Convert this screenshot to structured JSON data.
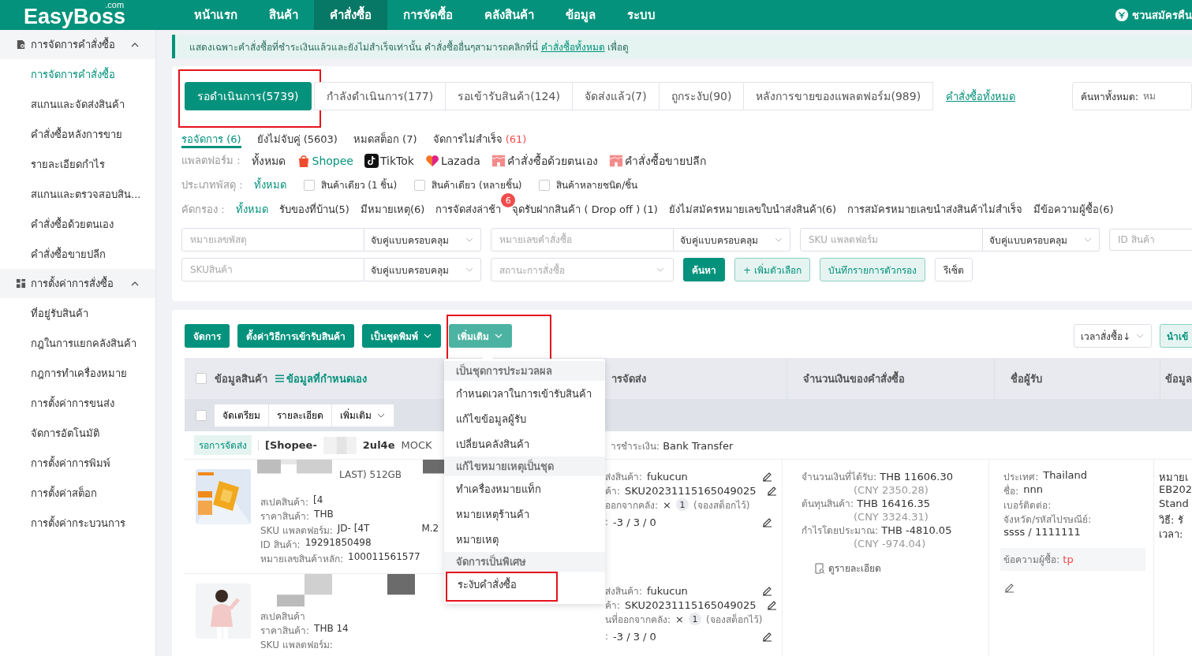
{
  "logo": {
    "text": "EasyBoss",
    "suffix": ".com"
  },
  "nav": [
    {
      "label": "หน้าแรก",
      "selected": false
    },
    {
      "label": "สินค้า",
      "selected": false
    },
    {
      "label": "คำสั่งซื้อ",
      "selected": true
    },
    {
      "label": "การจัดซื้อ",
      "selected": false
    },
    {
      "label": "คลังสินค้า",
      "selected": false
    },
    {
      "label": "ข้อมูล",
      "selected": false
    },
    {
      "label": "ระบบ",
      "selected": false
    }
  ],
  "invite": "ชวนสมัครคืน",
  "sidebar": [
    {
      "label": "การจัดการคำสั่งซื้อ",
      "kind": "doc",
      "expanded": true,
      "children": [
        {
          "label": "การจัดการคำสั่งซื้อ",
          "selected": true
        },
        {
          "label": "สแกนและจัดส่งสินค้า",
          "selected": false
        },
        {
          "label": "คำสั่งซื้อหลังการขาย",
          "selected": false
        },
        {
          "label": "รายละเอียดกำไร",
          "selected": false
        },
        {
          "label": "สแกนและตรวจสอบสิน...",
          "selected": false
        },
        {
          "label": "คำสั่งซื้อด้วยตนเอง",
          "selected": false
        },
        {
          "label": "คำสั่งซื้อขายปลีก",
          "selected": false
        }
      ]
    },
    {
      "label": "การตั้งค่าการสั่งซื้อ",
      "kind": "grid",
      "expanded": true,
      "children": [
        {
          "label": "ที่อยู่รับสินค้า",
          "selected": false
        },
        {
          "label": "กฎในการแยกคลังสินค้า",
          "selected": false
        },
        {
          "label": "กฎการทำเครื่องหมาย",
          "selected": false
        },
        {
          "label": "การตั้งค่าการขนส่ง",
          "selected": false
        },
        {
          "label": "จัดการอัตโนมัติ",
          "selected": false
        },
        {
          "label": "การตั้งค่าการพิมพ์",
          "selected": false
        },
        {
          "label": "การตั้งค่าสต็อก",
          "selected": false
        },
        {
          "label": "การตั้งค่ากระบวนการ",
          "selected": false
        }
      ]
    }
  ],
  "notice": {
    "text": "แสดงเฉพาะคำสั่งซื้อที่ชำระเงินแล้วและยังไม่สำเร็จเท่านั้น คำสั่งซื้ออื่นๆสามารถคลิกที่นี่",
    "link": "คำสั่งซื้อทั้งหมด",
    "tail": "เพื่อดู"
  },
  "status_tabs": [
    {
      "label": "รอดำเนินการ(5739)",
      "selected": true,
      "highlighted": true
    },
    {
      "label": "กำลังดำเนินการ(177)",
      "selected": false,
      "highlighted": false
    },
    {
      "label": "รอเข้ารับสินค้า(124)",
      "selected": false,
      "highlighted": false
    },
    {
      "label": "จัดส่งแล้ว(7)",
      "selected": false,
      "highlighted": false
    },
    {
      "label": "ถูกระงับ(90)",
      "selected": false,
      "highlighted": false
    },
    {
      "label": "หลังการขายของแพลตฟอร์ม(989)",
      "selected": false,
      "highlighted": false
    }
  ],
  "all_orders_link": "คำสั่งซื้อทั้งหมด",
  "global_search": {
    "label": "ค้นหาทั้งหมด:",
    "placeholder": "หม"
  },
  "sub_tabs": [
    {
      "label": "รอจัดการ",
      "count": "(6)",
      "selected": true,
      "alert": false
    },
    {
      "label": "ยังไม่จับคู่",
      "count": "(5603)",
      "selected": false,
      "alert": false
    },
    {
      "label": "หมดสต็อก",
      "count": "(7)",
      "selected": false,
      "alert": false
    },
    {
      "label": "จัดการไม่สำเร็จ",
      "count": "(61)",
      "selected": false,
      "alert": true
    }
  ],
  "platform": {
    "label": "แพลตฟอร์ม :",
    "options": [
      {
        "label": "ทั้งหมด",
        "kind": "all",
        "selected": false
      },
      {
        "label": "Shopee",
        "kind": "shopee",
        "selected": true
      },
      {
        "label": "TikTok",
        "kind": "tiktok",
        "selected": false
      },
      {
        "label": "Lazada",
        "kind": "lazada",
        "selected": false
      },
      {
        "label": "คำสั่งซื้อด้วยตนเอง",
        "kind": "store",
        "selected": false
      },
      {
        "label": "คำสั่งซื้อขายปลีก",
        "kind": "store",
        "selected": false
      }
    ]
  },
  "package_type": {
    "label": "ประเภทพัสดุ :",
    "all": {
      "label": "ทั้งหมด",
      "selected": true
    },
    "options": [
      {
        "label": "สินค้าเดียว (1 ชิ้น)",
        "checked": false
      },
      {
        "label": "สินค้าเดียว (หลายชิ้น)",
        "checked": false
      },
      {
        "label": "สินค้าหลายชนิด/ชิ้น",
        "checked": false
      }
    ]
  },
  "filters": {
    "label": "คัดกรอง :",
    "options": [
      {
        "label": "ทั้งหมด",
        "selected": true
      },
      {
        "label": "รับของที่บ้าน(5)",
        "selected": false
      },
      {
        "label": "มีหมายเหตุ(6)",
        "selected": false
      },
      {
        "label": "การจัดส่งล่าช้า",
        "selected": false,
        "badge": "6"
      },
      {
        "label": "จุดรับฝากสินค้า ( Drop off ) (1)",
        "selected": false
      },
      {
        "label": "ยังไม่สมัครหมายเลขใบนำส่งสินค้า(6)",
        "selected": false
      },
      {
        "label": "การสมัครหมายเลขนำส่งสินค้าไม่สำเร็จ",
        "selected": false
      },
      {
        "label": "มีข้อความผู้ซื้อ(6)",
        "selected": false
      }
    ]
  },
  "search_rows": [
    [
      {
        "kind": "text",
        "placeholder": "หมายเลขพัสดุ",
        "match": "จับคู่แบบครอบคลุม"
      },
      {
        "kind": "text",
        "placeholder": "หมายเลขคำสั่งซื้อ",
        "match": "จับคู่แบบครอบคลุม"
      },
      {
        "kind": "text",
        "placeholder": "SKU แพลตฟอร์ม",
        "match": "จับคู่แบบครอบคลุม"
      },
      {
        "kind": "plain",
        "placeholder": "ID สินค้า"
      }
    ],
    [
      {
        "kind": "text",
        "placeholder": "SKUสินค้า",
        "match": "จับคู่แบบครอบคลุม"
      },
      {
        "kind": "select",
        "placeholder": "สถานะการสั่งซื้อ"
      }
    ]
  ],
  "filter_buttons": [
    {
      "label": "ค้นหา",
      "kind": "primary"
    },
    {
      "label": "+ เพิ่มตัวเลือก",
      "kind": "light"
    },
    {
      "label": "บันทึกรายการตัวกรอง",
      "kind": "light"
    },
    {
      "label": "รีเซ็ต",
      "kind": "plain"
    }
  ],
  "toolbar": [
    {
      "label": "จัดการ",
      "caret": false,
      "active": false,
      "highlighted": false
    },
    {
      "label": "ตั้งค่าวิธีการเข้ารับสินค้า",
      "caret": false,
      "active": false,
      "highlighted": false
    },
    {
      "label": "เป็นชุดพิมพ์",
      "caret": true,
      "active": false,
      "highlighted": false
    },
    {
      "label": "เพิ่มเติม",
      "caret": true,
      "active": true,
      "highlighted": true
    }
  ],
  "sort": "เวลาสั่งซื้อ↓",
  "import_button": "นำเข้",
  "more_menu": [
    {
      "label": "เป็นชุดการประมวลผล",
      "kind": "group",
      "highlighted": false
    },
    {
      "label": "กำหนดเวลาในการเข้ารับสินค้า",
      "kind": "item",
      "highlighted": false
    },
    {
      "label": "แก้ไขข้อมูลผู้รับ",
      "kind": "item",
      "highlighted": false
    },
    {
      "label": "เปลี่ยนคลังสินค้า",
      "kind": "item",
      "highlighted": false
    },
    {
      "label": "แก้ไขหมายเหตุเป็นชุด",
      "kind": "group",
      "highlighted": false
    },
    {
      "label": "ทำเครื่องหมายแท็ก",
      "kind": "item",
      "highlighted": false
    },
    {
      "label": "หมายเหตุร้านค้า",
      "kind": "item",
      "highlighted": false
    },
    {
      "label": "หมายเหตุ",
      "kind": "item",
      "highlighted": false
    },
    {
      "label": "จัดการเป็นพิเศษ",
      "kind": "group",
      "highlighted": false
    },
    {
      "label": "ระงับคำสั่งซื้อ",
      "kind": "item",
      "highlighted": true
    }
  ],
  "table": {
    "columns": [
      "ข้อมูลสินค้า",
      "ารจัดส่ง",
      "จำนวนเงินของคำสั่งซื้อ",
      "ชื่อผู้รับ",
      "ข้อมูล"
    ],
    "custom_fields": "ข้อมูลที่กำหนดเอง",
    "header_checkbox": {
      "checked": false
    },
    "batch_checkbox": {
      "checked": false
    },
    "batch_buttons": [
      {
        "label": "จัดเตรียม",
        "caret": false
      },
      {
        "label": "รายละเอียด",
        "caret": false
      },
      {
        "label": "เพิ่มเติม",
        "caret": true
      }
    ]
  },
  "order": {
    "status": "รอการจัดส่ง",
    "shop": "[Shopee-",
    "order_no": "2ul4e",
    "mock": "MOCK",
    "payment_label": "ารชำระเงิน:",
    "payment": "Bank Transfer"
  },
  "products": [
    {
      "title": "LAST) 512GB",
      "lines": [
        {
          "label": "สเปคสินค้า:",
          "value": "[4"
        },
        {
          "label": "ราคาสินค้า:",
          "value": "THB"
        },
        {
          "label": "SKU แพลตฟอร์ม:",
          "value": "JD- [4T",
          "tail": "M.2"
        },
        {
          "label": "ID สินค้า:",
          "value": "19291850498"
        },
        {
          "label": "หมายเลขสินค้าหลัก:",
          "value": "100011561577"
        }
      ],
      "shipping": [
        {
          "label": "ส่งสินค้า:",
          "value": "fukucun",
          "editable": true
        },
        {
          "label": "ค้า:",
          "value": "SKU20231115165049025",
          "editable": true
        },
        {
          "label": "ออกจากคลัง:",
          "value": "×",
          "qty": "1",
          "note": "(จองสต็อกไว้)",
          "editable": false
        },
        {
          "label": ":",
          "value": "-3 / 3 / 0",
          "editable": true
        }
      ]
    },
    {
      "lines": [
        {
          "label": "สเปคสินค้า"
        },
        {
          "label": "ราคาสินค้า:",
          "value": "THB 14"
        },
        {
          "label": "SKU แพลตฟอร์ม:"
        }
      ],
      "shipping": [
        {
          "label": "ส่งสินค้า:",
          "value": "fukucun",
          "editable": true
        },
        {
          "label": "ค้า:",
          "value": "SKU20231115165049025",
          "editable": true
        },
        {
          "label": "นที่ออกจากคลัง:",
          "value": "×",
          "qty": "1",
          "note": "(จองสต็อกไว้)",
          "editable": false
        },
        {
          "label": ":",
          "value": "-3 / 3 / 0",
          "editable": true
        }
      ]
    }
  ],
  "amounts": [
    {
      "label": "จำนวนเงินที่ได้รับ:",
      "value": "THB 11606.30",
      "sub": "(CNY 2350.28)"
    },
    {
      "label": "ต้นทุนสินค้า:",
      "value": "THB 16416.35",
      "sub": "(CNY 3324.31)"
    },
    {
      "label": "กำไรโดยประมาณ:",
      "value": "THB -4810.05",
      "sub": "(CNY -974.04)"
    }
  ],
  "details_link": "ดูรายละเอียด",
  "receiver": [
    {
      "label": "ประเทศ:",
      "value": "Thailand"
    },
    {
      "label": "ชื่อ:",
      "value": "nnn"
    },
    {
      "label": "เบอร์ติดต่อ:"
    },
    {
      "label": "จังหวัด/รหัสไปรษณีย์:"
    },
    {
      "value": "ssss / 1111111"
    }
  ],
  "buyer_message": {
    "label": "ข้อความผู้ซื้อ:",
    "value": "tp"
  },
  "extra_column": [
    "หมายเ",
    "EB202",
    "Stand",
    "วิธี: รั",
    "เวลา:"
  ]
}
